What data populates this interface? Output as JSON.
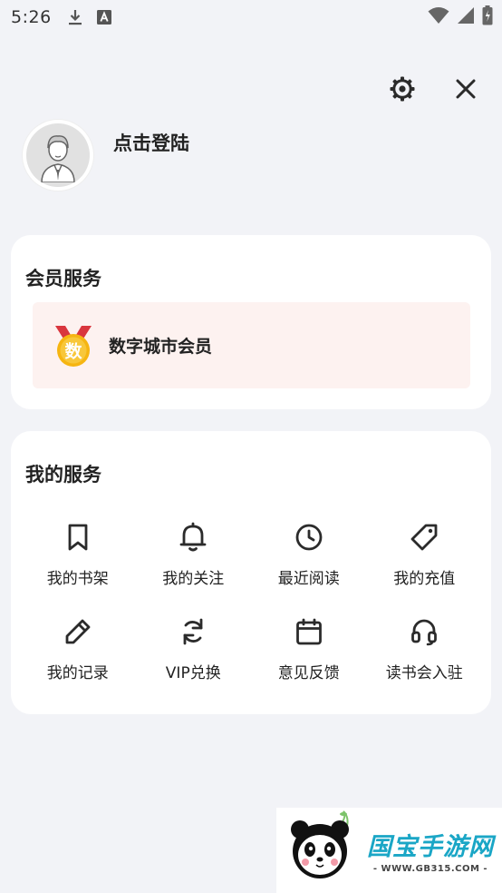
{
  "status_bar": {
    "time": "5:26",
    "left_icons": [
      "download-icon",
      "text-a-icon"
    ],
    "right_icons": [
      "wifi-icon",
      "signal-icon",
      "battery-icon"
    ]
  },
  "header": {
    "actions": [
      "settings-icon",
      "close-icon"
    ]
  },
  "profile": {
    "login_text": "点击登陆",
    "avatar_icon": "default-avatar-icon"
  },
  "vip_section": {
    "title": "会员服务",
    "badge_char": "数",
    "badge_icon": "medal-icon",
    "membership_label": "数字城市会员",
    "banner_bg": "#fdf2f0"
  },
  "services_section": {
    "title": "我的服务",
    "items": [
      {
        "label": "我的书架",
        "icon": "bookmark-icon"
      },
      {
        "label": "我的关注",
        "icon": "bell-icon"
      },
      {
        "label": "最近阅读",
        "icon": "clock-icon"
      },
      {
        "label": "我的充值",
        "icon": "tag-icon"
      },
      {
        "label": "我的记录",
        "icon": "pencil-icon"
      },
      {
        "label": "VIP兑换",
        "icon": "refresh-icon"
      },
      {
        "label": "意见反馈",
        "icon": "calendar-icon"
      },
      {
        "label": "读书会入驻",
        "icon": "headphones-icon"
      }
    ]
  },
  "watermark": {
    "title": "国宝手游网",
    "url": "- WWW.GB315.COM -",
    "logo_icon": "panda-logo-icon",
    "brand_color": "#1aa6c6"
  }
}
